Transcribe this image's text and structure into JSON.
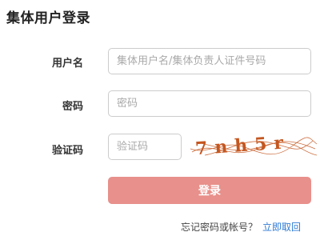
{
  "page_title": "集体用户登录",
  "form": {
    "username_label": "用户名",
    "username_placeholder": "集体用户名/集体负责人证件号码",
    "password_label": "密码",
    "password_placeholder": "密码",
    "captcha_label": "验证码",
    "captcha_placeholder": "验证码",
    "captcha_text": "7nh5r",
    "submit_label": "登录"
  },
  "footer": {
    "forgot_text": "忘记密码或帐号？",
    "recover_link": "立即取回"
  },
  "colors": {
    "submit_bg": "#e8908b",
    "link": "#2f7bd4",
    "captcha_ink": "#c4561f"
  }
}
